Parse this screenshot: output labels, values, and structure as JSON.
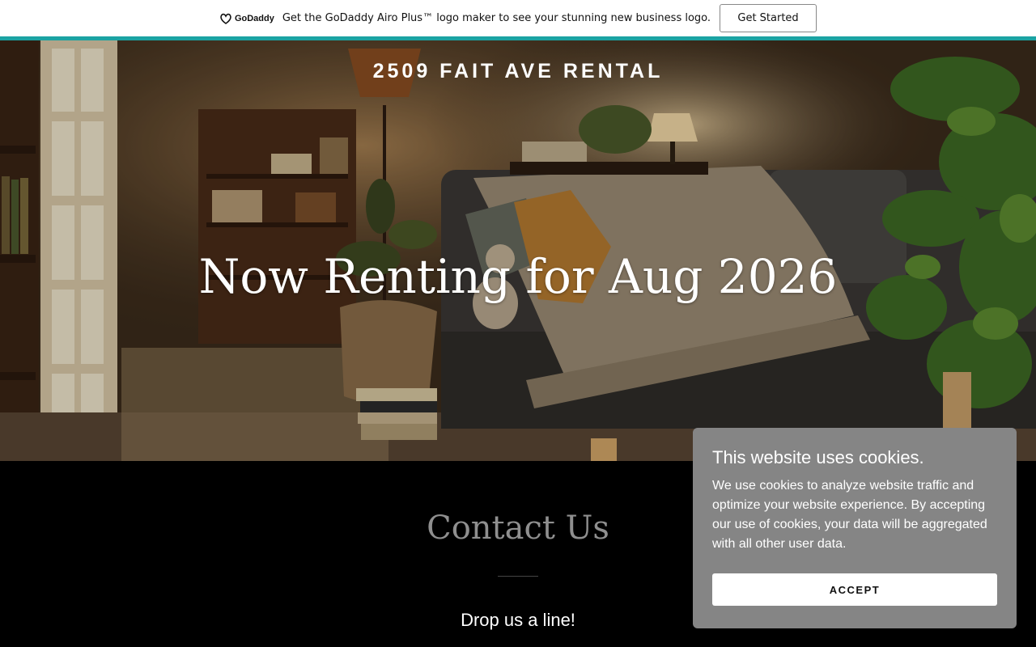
{
  "promo": {
    "brand": "GoDaddy",
    "text": "Get the GoDaddy Airo Plus™ logo maker to see your stunning new business logo.",
    "cta_label": "Get Started",
    "accent_color": "#1ba3a3"
  },
  "hero": {
    "site_title": "2509 FAIT AVE RENTAL",
    "headline": "Now Renting for Aug 2026"
  },
  "contact": {
    "heading": "Contact Us",
    "subheading": "Drop us a line!"
  },
  "cookie_banner": {
    "title": "This website uses cookies.",
    "body": "We use cookies to analyze website traffic and optimize your website experience. By accepting our use of cookies, your data will be aggregated with all other user data.",
    "accept_label": "ACCEPT",
    "background_color": "#858585"
  },
  "icons": {
    "brand_logo": "godaddy-logo-icon"
  }
}
